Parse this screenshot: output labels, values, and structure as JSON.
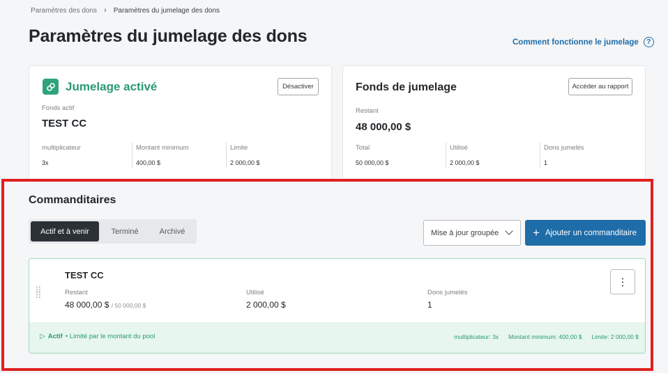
{
  "breadcrumb": {
    "parent": "Paramètres des dons",
    "current": "Paramètres du jumelage des dons"
  },
  "page": {
    "title": "Paramètres du jumelage des dons",
    "help_link": "Comment fonctionne le jumelage"
  },
  "status_card": {
    "title": "Jumelage activé",
    "deactivate_label": "Désactiver",
    "active_fund_label": "Fonds actif",
    "active_fund_value": "TEST CC",
    "stats": [
      {
        "label": "multiplicateur",
        "value": "3x"
      },
      {
        "label": "Montant minimum",
        "value": "400,00 $"
      },
      {
        "label": "Limite",
        "value": "2 000,00 $"
      }
    ]
  },
  "fund_card": {
    "title": "Fonds de jumelage",
    "report_label": "Accéder au rapport",
    "remaining_label": "Restant",
    "remaining_value": "48 000,00 $",
    "stats": [
      {
        "label": "Total",
        "value": "50 000,00 $"
      },
      {
        "label": "Utilisé",
        "value": "2 000,00 $"
      },
      {
        "label": "Dons jumelés",
        "value": "1"
      }
    ]
  },
  "sponsors": {
    "title": "Commanditaires",
    "tabs": [
      {
        "label": "Actif et à venir",
        "active": true
      },
      {
        "label": "Terminé",
        "active": false
      },
      {
        "label": "Archivé",
        "active": false
      }
    ],
    "bulk_update_label": "Mise à jour groupée",
    "add_label": "Ajouter un commanditaire",
    "items": [
      {
        "name": "TEST CC",
        "remaining_label": "Restant",
        "remaining_value": "48 000,00 $",
        "remaining_total": "/ 50 000,00 $",
        "used_label": "Utilisé",
        "used_value": "2 000,00 $",
        "matched_label": "Dons jumelés",
        "matched_value": "1",
        "status": "Actif",
        "status_note": "• Limité par le montant du pool",
        "multiplier": "multiplicateur: 3x",
        "minimum": "Montant minimum: 400,00 $",
        "limit": "Limite: 2 000,00 $"
      }
    ]
  },
  "colors": {
    "accent_green": "#2a9a70",
    "primary_blue": "#1e6ca8",
    "highlight_red": "#e02020"
  }
}
